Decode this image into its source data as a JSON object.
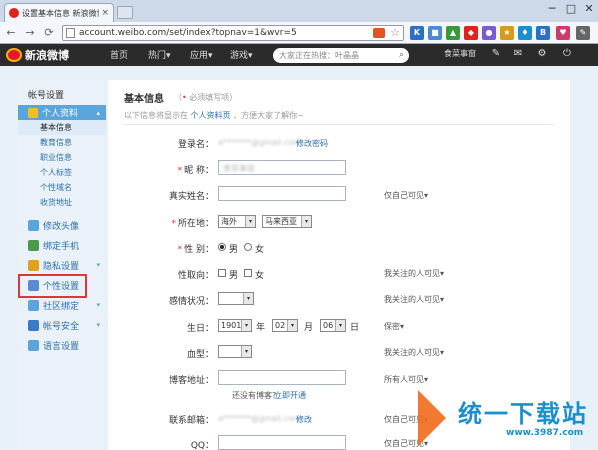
{
  "browser": {
    "tab_title": "设置基本信息 新浪微博-隐",
    "tab_close": "×",
    "url": "account.weibo.com/set/index?topnav=1&wvr=5",
    "window_controls": [
      "─",
      "□",
      "✕"
    ],
    "nav_buttons": [
      "←",
      "→",
      "⟳"
    ],
    "extensions": [
      {
        "name": "k-icon",
        "glyph": "K",
        "color": "#2a6fc8"
      },
      {
        "name": "extension-icon",
        "glyph": "■",
        "color": "#4a8ad8"
      },
      {
        "name": "extension-icon",
        "glyph": "▲",
        "color": "#3a9a3a"
      },
      {
        "name": "extension-icon",
        "glyph": "◆",
        "color": "#e2231a"
      },
      {
        "name": "extension-icon",
        "glyph": "●",
        "color": "#7a5ad0"
      },
      {
        "name": "extension-icon",
        "glyph": "★",
        "color": "#d89a1a"
      },
      {
        "name": "extension-icon",
        "glyph": "♦",
        "color": "#1a8fd0"
      },
      {
        "name": "bpa-icon",
        "glyph": "B",
        "color": "#2a6fc8"
      },
      {
        "name": "extension-icon",
        "glyph": "♥",
        "color": "#d03a6a"
      },
      {
        "name": "wrench-icon",
        "glyph": "✎",
        "color": "#666666"
      }
    ]
  },
  "weibo_nav": {
    "logo_text": "新浪微博",
    "items": [
      "首页",
      "热门▾",
      "应用▾",
      "游戏▾"
    ],
    "search_placeholder": "大家正在热搜：叶晶晶",
    "search_icon": "⌕",
    "user": "食菜事窗",
    "icons": [
      "✎",
      "✉",
      "⚙",
      "⏻",
      "☺"
    ]
  },
  "sidebar": {
    "title": "帐号设置",
    "group_personal": "个人资料",
    "group_chev": "▴",
    "subitems": [
      "基本信息",
      "教育信息",
      "职业信息",
      "个人标签",
      "个性域名",
      "收货地址"
    ],
    "items": [
      {
        "label": "修改头像",
        "color": "#5aa5dc",
        "chev": ""
      },
      {
        "label": "绑定手机",
        "color": "#4a9a4a",
        "chev": ""
      },
      {
        "label": "隐私设置",
        "color": "#e0a020",
        "chev": "▾"
      },
      {
        "label": "个性设置",
        "color": "#5a8ad0",
        "chev": ""
      },
      {
        "label": "社区绑定",
        "color": "#5aa5dc",
        "chev": "▾"
      },
      {
        "label": "帐号安全",
        "color": "#3a7ac8",
        "chev": "▾"
      },
      {
        "label": "语言设置",
        "color": "#5aa5dc",
        "chev": ""
      }
    ]
  },
  "main": {
    "title": "基本信息",
    "note_prefix": "（",
    "note_star": "•",
    "note_text": " 必须填写项）",
    "desc_prefix": "以下信息将显示在 ",
    "desc_link": "个人资料页",
    "desc_suffix": " ，方便大家了解你~",
    "login_label": "登录名：",
    "login_value": "a*******@gmail.com",
    "login_link": "修改密码",
    "nickname_label": "昵  称：",
    "nickname_value": "食菜事窗",
    "realname_label": "真实姓名：",
    "location_label": "所在地：",
    "location_country": "海外",
    "location_region": "马来西亚",
    "gender_label": "性  别：",
    "gender_male": "男",
    "gender_female": "女",
    "orientation_label": "性取向：",
    "orient_male": "男",
    "orient_female": "女",
    "relationship_label": "感情状况：",
    "birthday_label": "生日：",
    "birth_year": "1901",
    "birth_month": "02",
    "birth_day": "06",
    "unit_year": "年",
    "unit_month": "月",
    "unit_day": "日",
    "blood_label": "血型：",
    "blog_label": "博客地址：",
    "blog_hint": "还没有博客?",
    "blog_link": "立即开通",
    "email_label": "联系邮箱：",
    "email_value": "a*******@gmail.com",
    "email_link": "修改",
    "qq_label": "QQ：",
    "dd": "▾",
    "privacy_self": "仅自己可见▾",
    "privacy_follow": "我关注的人可见▾",
    "privacy_confidential": "保密▾",
    "privacy_all": "所有人可见▾",
    "req_star": "*"
  },
  "watermark": {
    "big": "统一下载站",
    "small": "www.3987.com"
  }
}
